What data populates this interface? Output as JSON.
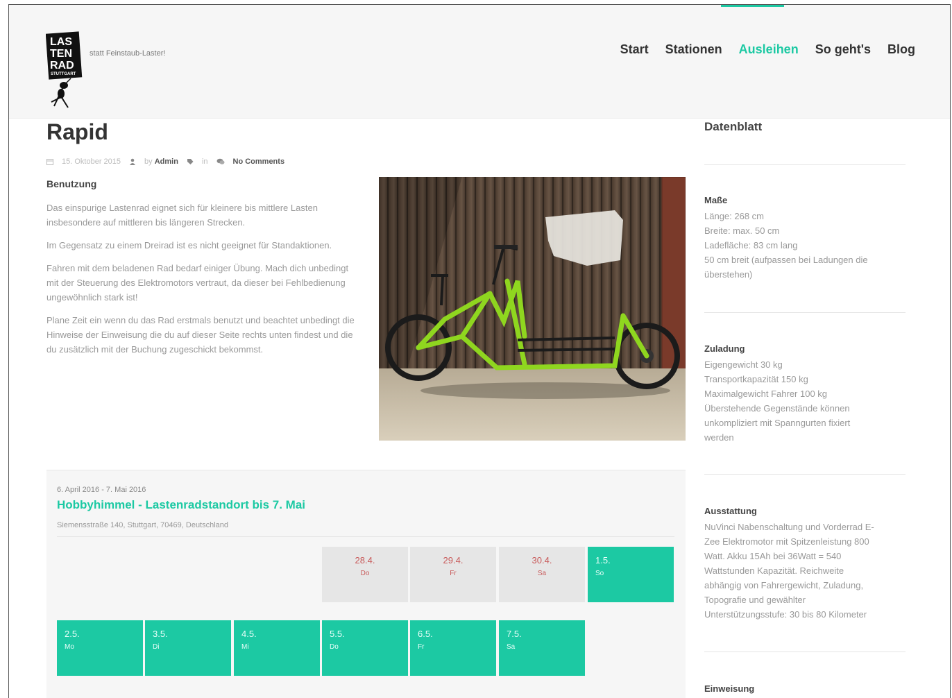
{
  "header": {
    "tagline": "statt Feinstaub-Laster!",
    "logo_text": "LAS TEN RAD STUTTGART",
    "nav": [
      {
        "label": "Start",
        "active": false
      },
      {
        "label": "Stationen",
        "active": false
      },
      {
        "label": "Ausleihen",
        "active": true
      },
      {
        "label": "So geht's",
        "active": false
      },
      {
        "label": "Blog",
        "active": false
      }
    ]
  },
  "post": {
    "title": "Rapid",
    "meta": {
      "date": "15. Oktober 2015",
      "author_prefix": "by",
      "author": "Admin",
      "category_prefix": "in",
      "comments": "No Comments"
    },
    "section_heading": "Benutzung",
    "paragraphs": [
      "Das einspurige Lastenrad eignet sich für kleinere bis mittlere Lasten insbesondere auf mittleren bis längeren Strecken.",
      "Im Gegensatz zu einem Dreirad ist es nicht geeignet für Standaktionen.",
      "Fahren mit dem beladenen Rad bedarf einiger Übung. Mach dich unbedingt mit der Steuerung des Elektromotors vertraut, da dieser bei Fehlbedienung ungewöhnlich stark ist!",
      "Plane Zeit ein wenn du das Rad erstmals benutzt und beachtet unbedingt die Hinweise der Einweisung die du auf dieser Seite rechts unten findest und die du zusätzlich mit der Buchung zugeschickt bekommst."
    ]
  },
  "sidebar": {
    "title": "Datenblatt",
    "sections": [
      {
        "heading": "Maße",
        "lines": [
          "Länge: 268 cm",
          "Breite: max. 50 cm",
          "Ladefläche: 83 cm lang",
          "50 cm breit (aufpassen bei Ladungen die",
          "überstehen)"
        ]
      },
      {
        "heading": "Zuladung",
        "lines": [
          "Eigengewicht 30 kg",
          "Transportkapazität 150 kg",
          "Maximalgewicht Fahrer 100 kg",
          "Überstehende Gegenstände können",
          "unkompliziert mit Spanngurten fixiert",
          "werden"
        ]
      },
      {
        "heading": "Ausstattung",
        "lines": [
          "NuVinci Nabenschaltung und Vorderrad E-",
          "Zee Elektromotor mit Spitzenleistung 800",
          "Watt. Akku 15Ah bei 36Watt = 540",
          "Wattstunden Kapazität. Reichweite",
          "abhängig von Fahrergewicht, Zuladung,",
          "Topografie und gewählter",
          "Unterstützungsstufe: 30 bis 80 Kilometer"
        ]
      },
      {
        "heading": "Einweisung",
        "lines": []
      }
    ]
  },
  "booking": {
    "dates": "6. April 2016 - 7. Mai 2016",
    "location": "Hobbyhimmel - Lastenradstandort bis 7. Mai",
    "address": "Siemensstraße 140, Stuttgart, 70469, Deutschland",
    "row1": [
      {
        "date": "28.4.",
        "day": "Do",
        "state": "past"
      },
      {
        "date": "29.4.",
        "day": "Fr",
        "state": "past"
      },
      {
        "date": "30.4.",
        "day": "Sa",
        "state": "past"
      },
      {
        "date": "1.5.",
        "day": "So",
        "state": "free"
      }
    ],
    "row2": [
      {
        "date": "2.5.",
        "day": "Mo",
        "state": "free"
      },
      {
        "date": "3.5.",
        "day": "Di",
        "state": "free"
      },
      {
        "date": "4.5.",
        "day": "Mi",
        "state": "free"
      },
      {
        "date": "5.5.",
        "day": "Do",
        "state": "free"
      },
      {
        "date": "6.5.",
        "day": "Fr",
        "state": "free"
      },
      {
        "date": "7.5.",
        "day": "Sa",
        "state": "free"
      }
    ]
  },
  "colors": {
    "accent": "#1cc9a3",
    "past_text": "#c85a5a",
    "bike": "#8fd61f"
  }
}
